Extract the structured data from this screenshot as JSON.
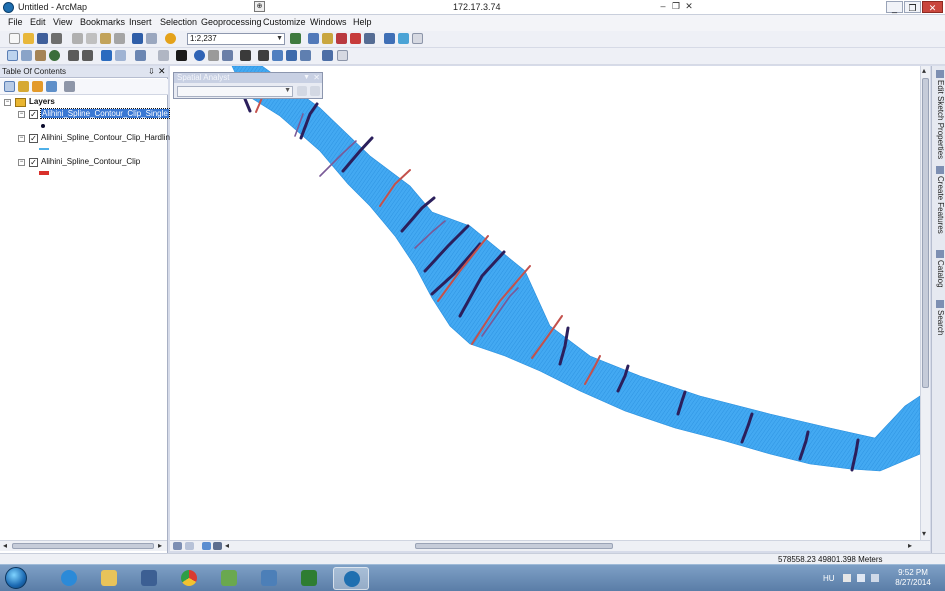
{
  "window": {
    "title": "Untitled - ArcMap",
    "remote_host": "172.17.3.74",
    "minimize": "_",
    "restore": "❐",
    "close": "✕"
  },
  "menu": [
    "File",
    "Edit",
    "View",
    "Bookmarks",
    "Insert",
    "Selection",
    "Geoprocessing",
    "Customize",
    "Windows",
    "Help"
  ],
  "toolbar": {
    "scale_value": "1:2,237"
  },
  "toc": {
    "title": "Table Of Contents",
    "pin": "⇩",
    "close": "✕",
    "root_label": "Layers",
    "layers": [
      {
        "label": "Alihini_Spline_Contour_Clip_Single",
        "selected": true,
        "symbol": "dot",
        "color": "#0a0a2c"
      },
      {
        "label": "Alihini_Spline_Contour_Clip_Hardlin",
        "selected": false,
        "symbol": "line",
        "color": "#4fb0e8"
      },
      {
        "label": "Alihini_Spline_Contour_Clip",
        "selected": false,
        "symbol": "rect",
        "color": "#d9312b"
      }
    ]
  },
  "spatial_analyst": {
    "title": "Spatial Analyst"
  },
  "right_dock": {
    "tabs": [
      "Edit Sketch Properties",
      "Create Features",
      "Catalog",
      "Search"
    ]
  },
  "status": {
    "coordinates": "578558.23  49801.398 Meters"
  },
  "taskbar": {
    "language": "HU",
    "time": "9:52 PM",
    "date": "8/27/2014"
  },
  "colors": {
    "river_fill": "#3ea6f0",
    "contour_dark": "#2b1f5c",
    "contour_red": "#c4514c",
    "selection": "#3a78d3"
  }
}
